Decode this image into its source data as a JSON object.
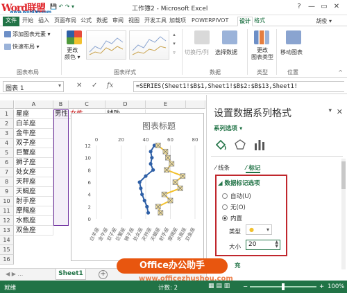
{
  "window": {
    "brand": "Word联盟",
    "brand_url": "www.wordlm.com",
    "title": "工作簿2 - Microsoft Excel",
    "help": "?",
    "minimize": "—",
    "restore": "▭",
    "close": "✕"
  },
  "tabs": [
    "文件",
    "开始",
    "插入",
    "页面布局",
    "公式",
    "数据",
    "审阅",
    "视图",
    "开发工具",
    "加载项",
    "POWERPIVOT",
    "设计",
    "格式"
  ],
  "active_tab": "设计",
  "user": "胡俊 ▾",
  "ribbon": {
    "add_element": "添加图表元素 ▾",
    "quick_layout": "快速布局 ▾",
    "change_colors": "更改\n颜色 ▾",
    "switch_rowcol": "切换行/列",
    "select_data": "选择数据",
    "change_type": "更改\n图表类型",
    "move_chart": "移动图表",
    "groups": {
      "layout": "图表布局",
      "styles": "图表样式",
      "data": "数据",
      "type": "类型",
      "location": "位置"
    }
  },
  "formula_bar": {
    "name_box": "图表 1",
    "fx": "fx",
    "formula": "=SERIES(Sheet1!$B$1,Sheet1!$B$2:$B$13,Sheet1!"
  },
  "sheet": {
    "columns": [
      "A",
      "B",
      "C",
      "D",
      "E"
    ],
    "rows": [
      "1",
      "2",
      "3",
      "4",
      "5",
      "6",
      "7",
      "8",
      "9",
      "10",
      "11",
      "12",
      "13",
      "14",
      "15",
      "16"
    ],
    "col_a": [
      "星座",
      "白羊座",
      "金牛座",
      "双子座",
      "巨蟹座",
      "狮子座",
      "处女座",
      "天秤座",
      "天蝎座",
      "射手座",
      "摩羯座",
      "水瓶座",
      "双鱼座"
    ],
    "b1": "男性",
    "c1": "女性",
    "d1": "辅助"
  },
  "chart_data": {
    "type": "line",
    "title": "图表标题",
    "categories": [
      "白羊座",
      "金牛座",
      "双子座",
      "巨蟹座",
      "狮子座",
      "处女座",
      "天秤座",
      "天蝎座",
      "射手座",
      "摩羯座",
      "水瓶座",
      "双鱼座"
    ],
    "x_ticks": [
      "0",
      "20",
      "40",
      "60",
      "80"
    ],
    "y_ticks": [
      "0",
      "2",
      "4",
      "6",
      "8",
      "10",
      "12"
    ],
    "xlim": [
      0,
      80
    ],
    "ylim": [
      0,
      12
    ],
    "series": [
      {
        "values": [
          42,
          41,
          39,
          37,
          36,
          35,
          40,
          46,
          44,
          45,
          44,
          47
        ],
        "color": "#2e5fa6"
      },
      {
        "values": [
          52,
          50,
          60,
          55,
          68,
          64,
          70,
          57,
          61,
          58,
          56,
          50
        ],
        "color": "#f2c12e"
      }
    ]
  },
  "sheet_tabs": {
    "active": "Sheet1",
    "add": "+"
  },
  "status": {
    "ready": "就绪",
    "count": "计数: 2",
    "zoom": "100%"
  },
  "pane": {
    "title": "设置数据系列格式",
    "series_options": "系列选项 ▾",
    "sub_tabs": {
      "line": "线条",
      "marker": "标记"
    },
    "section": "◢ 数据标记选项",
    "auto": "自动(U)",
    "none": "无(O)",
    "builtin": "内置",
    "type_label": "类型",
    "size_label": "大小",
    "size_value": "20",
    "fill_partial": "充"
  },
  "watermark": {
    "main": "Office办公助手",
    "url": "www.officezhushou.com"
  }
}
